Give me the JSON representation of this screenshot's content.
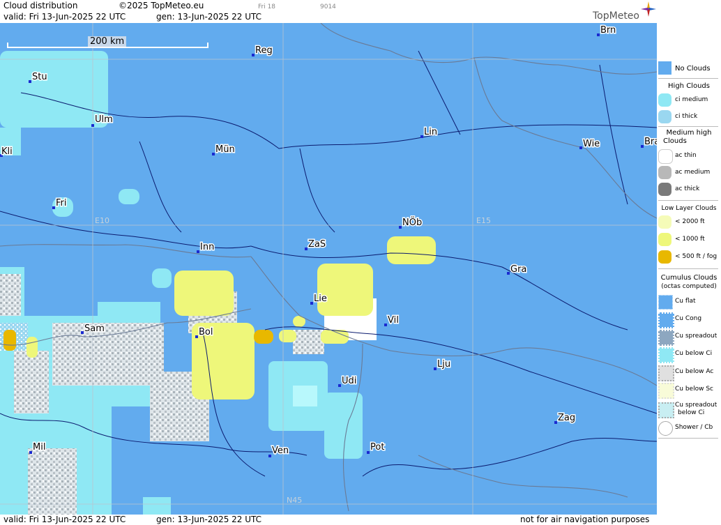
{
  "header": {
    "title": "Cloud distribution",
    "copyright": "©2025 TopMeteo.eu",
    "forecast_day": "Fri 18",
    "code": "9014",
    "valid": "valid:  Fri  13-Jun-2025  22 UTC",
    "generated": "gen: 13-Jun-2025 22 UTC",
    "logo": "TopMeteo"
  },
  "footer": {
    "valid": "valid:  Fri  13-Jun-2025  22 UTC",
    "generated": "gen: 13-Jun-2025 22 UTC",
    "notice": "not for air navigation purposes"
  },
  "map": {
    "scale_label": "200 km",
    "grid_labels": {
      "e10": "E10",
      "e15": "E15",
      "n45": "N45"
    },
    "cities": [
      "Brn",
      "Reg",
      "Stu",
      "Ulm",
      "Lin",
      "Kli",
      "Mün",
      "Wie",
      "Bra",
      "Fri",
      "NÖb",
      "Inn",
      "ZaS",
      "Gra",
      "Lie",
      "Sam",
      "Vil",
      "Bol",
      "Lju",
      "Udi",
      "Zag",
      "Mil",
      "Ven",
      "Pot"
    ],
    "colors": {
      "no_clouds": "#62abee",
      "ci": "#8fe8f4",
      "low": "#eef77a",
      "fog": "#e8b800",
      "ac_thin": "#ffffff"
    }
  },
  "legend": {
    "no_clouds": "No Clouds",
    "high_clouds": "High Clouds",
    "ci_medium": "ci medium",
    "ci_thick": "ci thick",
    "medium_high_l1": "Medium high",
    "medium_high_l2": "Clouds",
    "ac_thin": "ac thin",
    "ac_medium": "ac medium",
    "ac_thick": "ac thick",
    "low_layer": "Low Layer Clouds",
    "lt2000": "< 2000 ft",
    "lt1000": "< 1000 ft",
    "lt500": "< 500 ft / fog",
    "cumulus_l1": "Cumulus Clouds",
    "cumulus_l2": "(octas computed)",
    "cu_flat": "Cu flat",
    "cu_cong": "Cu Cong",
    "cu_spreadout": "Cu spreadout",
    "cu_below_ci": "Cu below Ci",
    "cu_below_ac": "Cu below Ac",
    "cu_below_sc": "Cu below Sc",
    "cu_spread_ci_l1": "Cu spreadout",
    "cu_spread_ci_l2": "below Ci",
    "shower_cb": "Shower / Cb"
  }
}
